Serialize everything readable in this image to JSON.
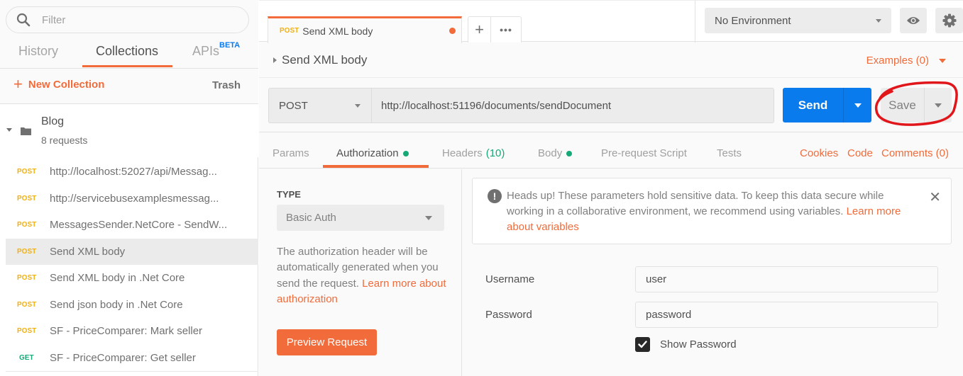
{
  "sidebar": {
    "filter_placeholder": "Filter",
    "tabs": [
      {
        "label": "History"
      },
      {
        "label": "Collections",
        "active": true
      },
      {
        "label": "APIs",
        "badge": "BETA"
      }
    ],
    "new_collection_label": "New Collection",
    "trash_label": "Trash",
    "collection": {
      "name": "Blog",
      "count": "8 requests"
    },
    "requests": [
      {
        "method": "POST",
        "name": "http://localhost:52027/api/Messag..."
      },
      {
        "method": "POST",
        "name": "http://servicebusexamplesmessag..."
      },
      {
        "method": "POST",
        "name": "MessagesSender.NetCore - SendW..."
      },
      {
        "method": "POST",
        "name": "Send XML body",
        "active": true
      },
      {
        "method": "POST",
        "name": "Send XML body in .Net Core"
      },
      {
        "method": "POST",
        "name": "Send json body in .Net Core"
      },
      {
        "method": "POST",
        "name": "SF - PriceComparer: Mark seller"
      },
      {
        "method": "GET",
        "name": "SF - PriceComparer: Get seller"
      }
    ]
  },
  "topbar": {
    "open_tab": {
      "method": "POST",
      "name": "Send XML body",
      "unsaved": true
    },
    "new_tab_icon": "plus-icon",
    "more_icon": "ellipsis-icon",
    "environment": "No Environment",
    "eye_icon": "eye-icon",
    "settings_icon": "gear-icon"
  },
  "request": {
    "title": "Send XML body",
    "examples_label": "Examples (0)",
    "method": "POST",
    "url": "http://localhost:51196/documents/sendDocument",
    "send_label": "Send",
    "save_label": "Save",
    "tabs": [
      {
        "label": "Params"
      },
      {
        "label": "Authorization",
        "indicator": true,
        "active": true
      },
      {
        "label": "Headers",
        "count": "(10)"
      },
      {
        "label": "Body",
        "indicator": true
      },
      {
        "label": "Pre-request Script"
      },
      {
        "label": "Tests"
      }
    ],
    "links": [
      "Cookies",
      "Code",
      "Comments (0)"
    ]
  },
  "auth": {
    "type_label": "TYPE",
    "type_value": "Basic Auth",
    "description": "The authorization header will be automatically generated when you send the request. ",
    "description_link": "Learn more about authorization",
    "preview_label": "Preview Request",
    "alert_text": "Heads up! These parameters hold sensitive data. To keep this data secure while working in a collaborative environment, we recommend using variables. ",
    "alert_link": "Learn more about variables",
    "username_label": "Username",
    "username_value": "user",
    "password_label": "Password",
    "password_value": "password",
    "show_password_label": "Show Password",
    "show_password_checked": true
  },
  "colors": {
    "accent": "#f26b3a",
    "send": "#097bed",
    "post": "#f4b10b",
    "get": "#16a976",
    "annotation": "#e0161b"
  }
}
